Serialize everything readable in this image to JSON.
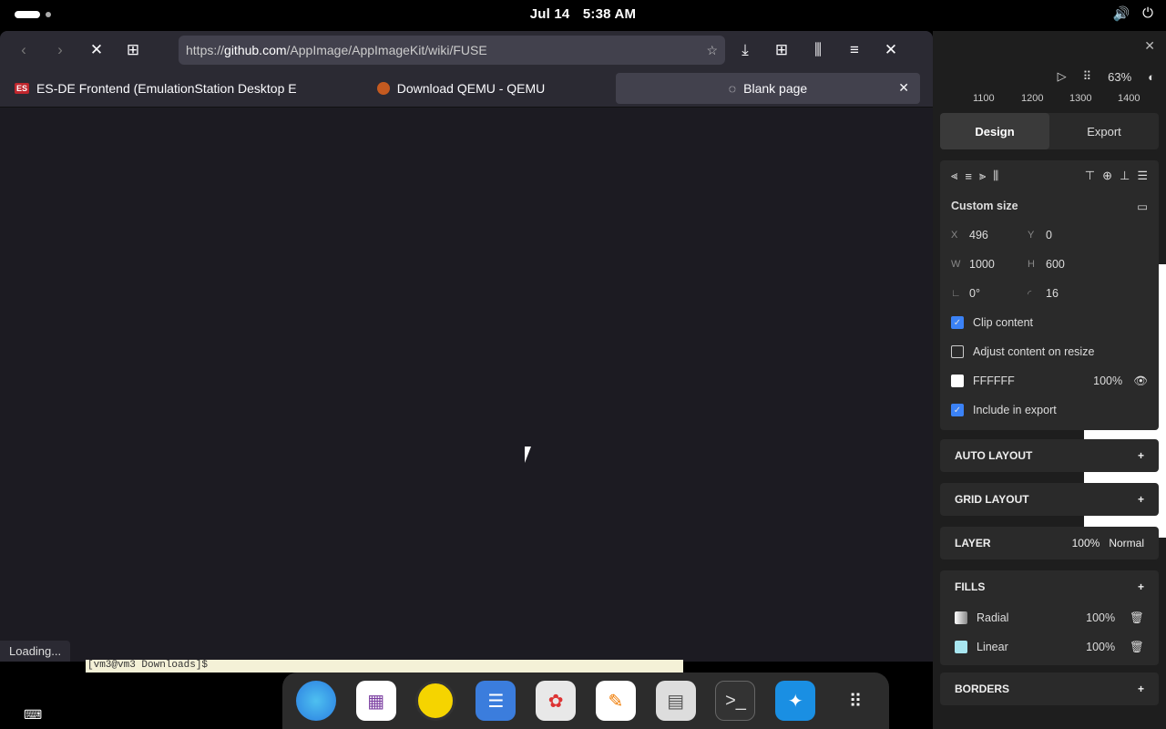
{
  "system": {
    "date": "Jul 14",
    "time": "5:38 AM"
  },
  "browser": {
    "url_prefix": "https://",
    "url_host": "github.com",
    "url_path": "/AppImage/AppImageKit/wiki/FUSE",
    "tabs": [
      {
        "label": "ES-DE Frontend (EmulationStation Desktop E",
        "favicon": "ES"
      },
      {
        "label": "Download QEMU - QEMU"
      },
      {
        "label": "Blank page"
      }
    ],
    "status": "Loading..."
  },
  "editor": {
    "zoom": "63%",
    "ruler": [
      "1100",
      "1200",
      "1300",
      "1400"
    ],
    "tab_design": "Design",
    "tab_export": "Export",
    "size_preset": "Custom size",
    "x_label": "X",
    "x_value": "496",
    "y_label": "Y",
    "y_value": "0",
    "w_label": "W",
    "w_value": "1000",
    "h_label": "H",
    "h_value": "600",
    "rotation": "0°",
    "radius": "16",
    "clip_content": "Clip content",
    "adjust_content": "Adjust content on resize",
    "fill_hex": "FFFFFF",
    "fill_opacity": "100%",
    "include_export": "Include in export",
    "auto_layout": "AUTO LAYOUT",
    "grid_layout": "GRID LAYOUT",
    "layer": "LAYER",
    "layer_opacity": "100%",
    "layer_blend": "Normal",
    "fills": "FILLS",
    "fill1_name": "Radial",
    "fill1_opacity": "100%",
    "fill2_name": "Linear",
    "fill2_opacity": "100%",
    "borders": "BORDERS"
  },
  "terminal": {
    "prompt": "[vm3@vm3 Downloads]$"
  }
}
